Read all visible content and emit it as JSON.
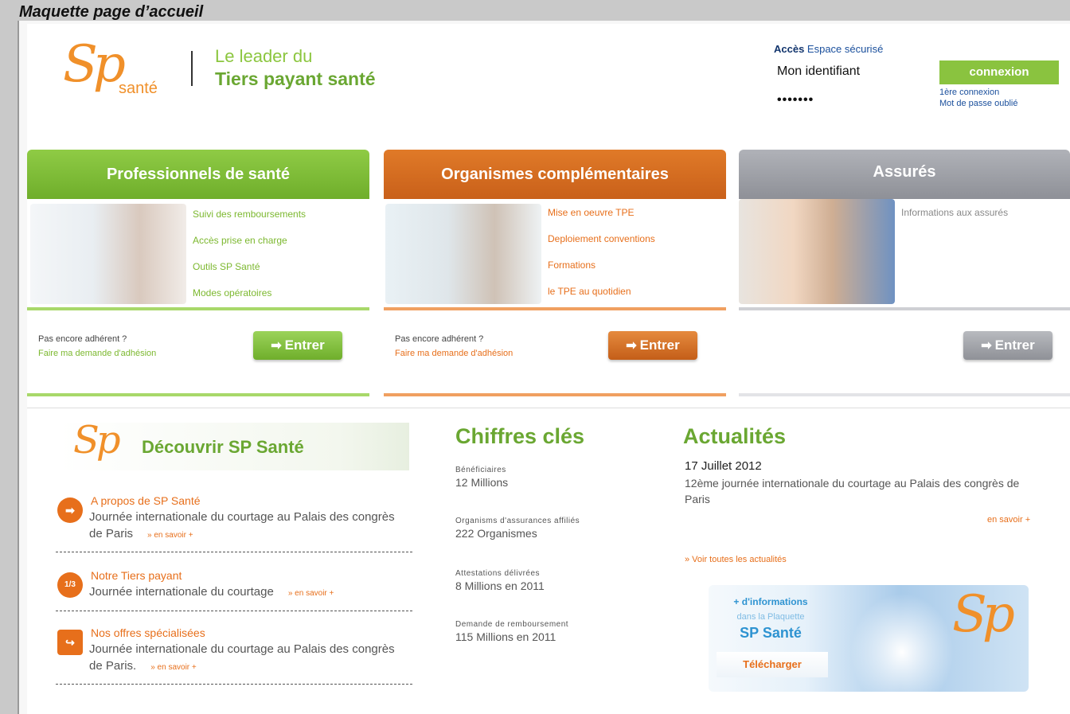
{
  "caption": "Maquette page d’accueil",
  "header": {
    "logo_sp": "Sp",
    "logo_sante": "santé",
    "tagline_1": "Le leader du",
    "tagline_2": "Tiers payant santé"
  },
  "login": {
    "title_strong": "Accès",
    "title_rest": " Espace sécurisé",
    "identifier_value": "Mon identifiant",
    "password_value": "•••••••",
    "connect_label": "connexion",
    "first_connection": "1ère connexion",
    "forgot_password": "Mot de passe oublié"
  },
  "columns": [
    {
      "title": "Professionnels de santé",
      "color": "#7cb82f",
      "links": [
        "Suivi des remboursements",
        "Accès prise en charge",
        "Outils SP Santé",
        "Modes opératoires"
      ],
      "not_member": "Pas encore adhérent ?",
      "ask_link": "Faire ma demande d'adhésion",
      "enter_label": "Entrer"
    },
    {
      "title": "Organismes complémentaires",
      "color": "#d5691d",
      "links": [
        "Mise en oeuvre TPE",
        "Deploiement conventions",
        "Formations",
        "le TPE au quotidien"
      ],
      "not_member": "Pas encore adhérent ?",
      "ask_link": "Faire ma demande d'adhésion",
      "enter_label": "Entrer"
    },
    {
      "title": "Assurés",
      "color": "#9a9ca3",
      "links": [
        "Informations aux assurés"
      ],
      "enter_label": "Entrer"
    }
  ],
  "discover": {
    "logo": "Sp",
    "title": "Découvrir SP Santé",
    "items": [
      {
        "icon": "arrow-right-icon",
        "icon_glyph": "➡",
        "title": "A propos de SP Santé",
        "desc": "Journée internationale du courtage au Palais des congrès de Paris",
        "more": "» en savoir +"
      },
      {
        "icon": "speech-bubble-icon",
        "icon_glyph": "1/3",
        "title": "Notre Tiers payant",
        "desc": "Journée internationale du courtage",
        "more": "» en savoir +"
      },
      {
        "icon": "share-icon",
        "icon_glyph": "↪",
        "title": "Nos offres spécialisées",
        "desc": "Journée internationale du courtage au Palais des congrès de Paris.",
        "more": "» en savoir +"
      }
    ]
  },
  "key_figures": {
    "title": "Chiffres clés",
    "items": [
      {
        "label": "Bénéficiaires",
        "value": "12 Millions"
      },
      {
        "label": "Organisms d'assurances affiliés",
        "value": "222 Organismes"
      },
      {
        "label": "Attestations délivrées",
        "value": "8 Millions en 2011"
      },
      {
        "label": "Demande de remboursement",
        "value": "115 Millions en 2011"
      }
    ]
  },
  "news": {
    "title": "Actualités",
    "date": "17 Juillet 2012",
    "text": "12ème journée internationale du courtage au Palais des congrès de Paris",
    "more": "en savoir +",
    "all": "» Voir toutes les actualités",
    "banner_line1": "+ d'informations",
    "banner_line2": "dans la Plaquette",
    "banner_line3": "SP Santé",
    "banner_download": "Télécharger",
    "banner_logo": "Sp"
  }
}
